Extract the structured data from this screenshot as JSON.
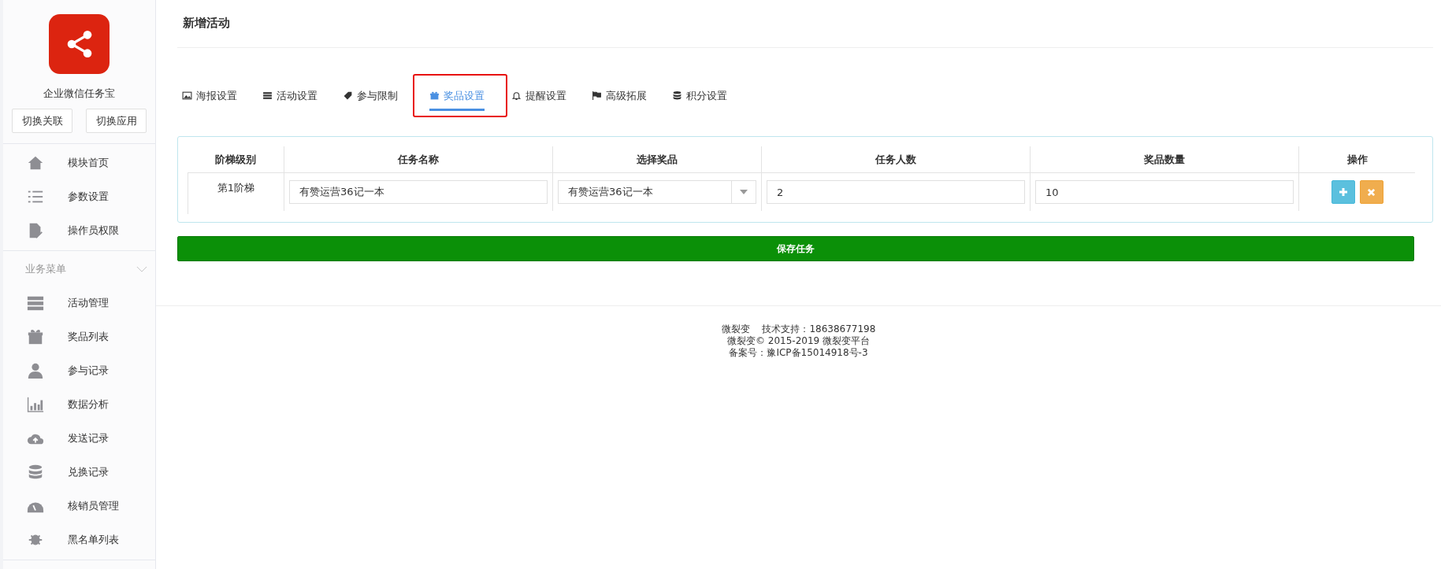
{
  "sidebar": {
    "app_name": "企业微信任务宝",
    "buttons": [
      "切换关联",
      "切换应用"
    ],
    "items": [
      {
        "label": "模块首页"
      },
      {
        "label": "参数设置"
      },
      {
        "label": "操作员权限"
      }
    ],
    "section": {
      "label": "业务菜单",
      "expanded": true,
      "items": [
        {
          "label": "活动管理"
        },
        {
          "label": "奖品列表"
        },
        {
          "label": "参与记录"
        },
        {
          "label": "数据分析"
        },
        {
          "label": "发送记录"
        },
        {
          "label": "兑换记录"
        },
        {
          "label": "核销员管理"
        },
        {
          "label": "黑名单列表"
        }
      ]
    }
  },
  "page_title": "新增活动",
  "tabs": [
    {
      "label": "海报设置",
      "selected": false,
      "highlighted": false
    },
    {
      "label": "活动设置",
      "selected": false,
      "highlighted": false
    },
    {
      "label": "参与限制",
      "selected": false,
      "highlighted": false
    },
    {
      "label": "奖品设置",
      "selected": true,
      "highlighted": true
    },
    {
      "label": "提醒设置",
      "selected": false,
      "highlighted": false
    },
    {
      "label": "高级拓展",
      "selected": false,
      "highlighted": false
    },
    {
      "label": "积分设置",
      "selected": false,
      "highlighted": false
    }
  ],
  "table": {
    "columns": [
      "阶梯级别",
      "任务名称",
      "选择奖品",
      "任务人数",
      "奖品数量",
      "操作"
    ],
    "rows": [
      {
        "level": "第1阶梯",
        "task_name": "有赞运营36记一本",
        "prize": "有赞运营36记一本",
        "people": "2",
        "quantity": "10"
      }
    ]
  },
  "save_button": "保存任务",
  "footer": [
    "微裂变　  技术支持：18638677198",
    "微裂变© 2015-2019 微裂变平台",
    "备案号：豫ICP备15014918号-3"
  ]
}
